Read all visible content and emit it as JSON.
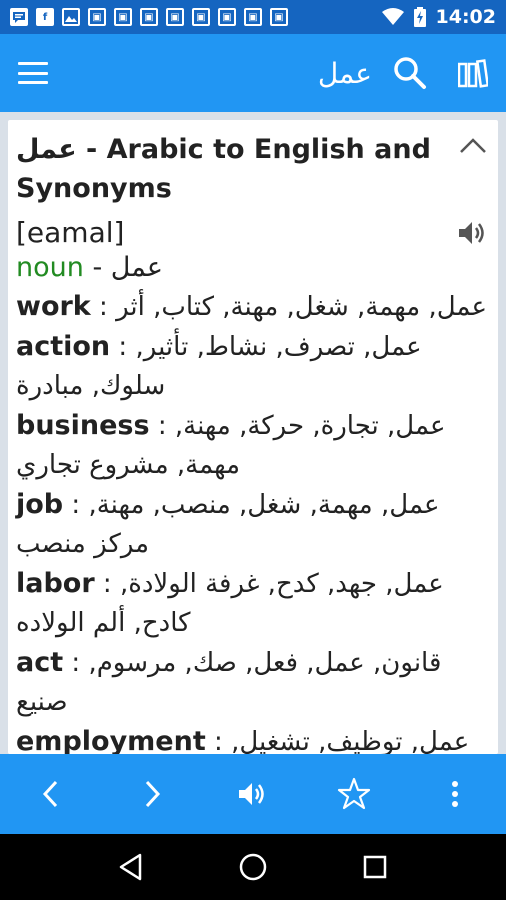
{
  "status_bar": {
    "time": "14:02",
    "icons": [
      "message-icon",
      "facebook-icon",
      "image-icon",
      "app-icon",
      "app-icon",
      "app-icon",
      "app-icon",
      "app-icon",
      "app-icon",
      "app-icon",
      "app-icon",
      "wifi-icon",
      "battery-charging-icon"
    ]
  },
  "app_bar": {
    "title": "عمل",
    "menu_icon": "hamburger-icon",
    "search_icon": "search-icon",
    "books_icon": "books-icon"
  },
  "entry": {
    "heading": "عمل - Arabic to English and Synonyms",
    "phonetic": "[eamal]",
    "pos": "noun",
    "pos_word": "عمل",
    "pos_sep": " - ",
    "meanings": [
      {
        "word": "work",
        "synonyms": "عمل, مهمة, شغل, مهنة, كتاب, أثر"
      },
      {
        "word": "action",
        "synonyms": "عمل, تصرف, نشاط, تأثير, سلوك, مبادرة"
      },
      {
        "word": "business",
        "synonyms": "عمل, تجارة, حركة, مهنة, مهمة, مشروع تجاري"
      },
      {
        "word": "job",
        "synonyms": "عمل, مهمة, شغل, منصب, مهنة, مركز منصب"
      },
      {
        "word": "labor",
        "synonyms": "عمل, جهد, كدح, غرفة الولادة, كادح, ألم الولاده"
      },
      {
        "word": "act",
        "synonyms": "قانون, عمل, فعل, صك, مرسوم, صنيع"
      },
      {
        "word": "employment",
        "synonyms": "عمل, توظيف, تشغيل, استخدام, استعمال"
      }
    ],
    "separator": " : "
  },
  "bottom_bar": {
    "icons": [
      "back-icon",
      "forward-icon",
      "speaker-icon",
      "star-icon",
      "more-vert-icon"
    ]
  },
  "nav_bar": {
    "icons": [
      "nav-back-icon",
      "nav-home-icon",
      "nav-recents-icon"
    ]
  },
  "colors": {
    "status_bar": "#1565c0",
    "app_bar": "#2196f3",
    "pos": "#228b22",
    "content_bg": "#d9e0e8"
  }
}
